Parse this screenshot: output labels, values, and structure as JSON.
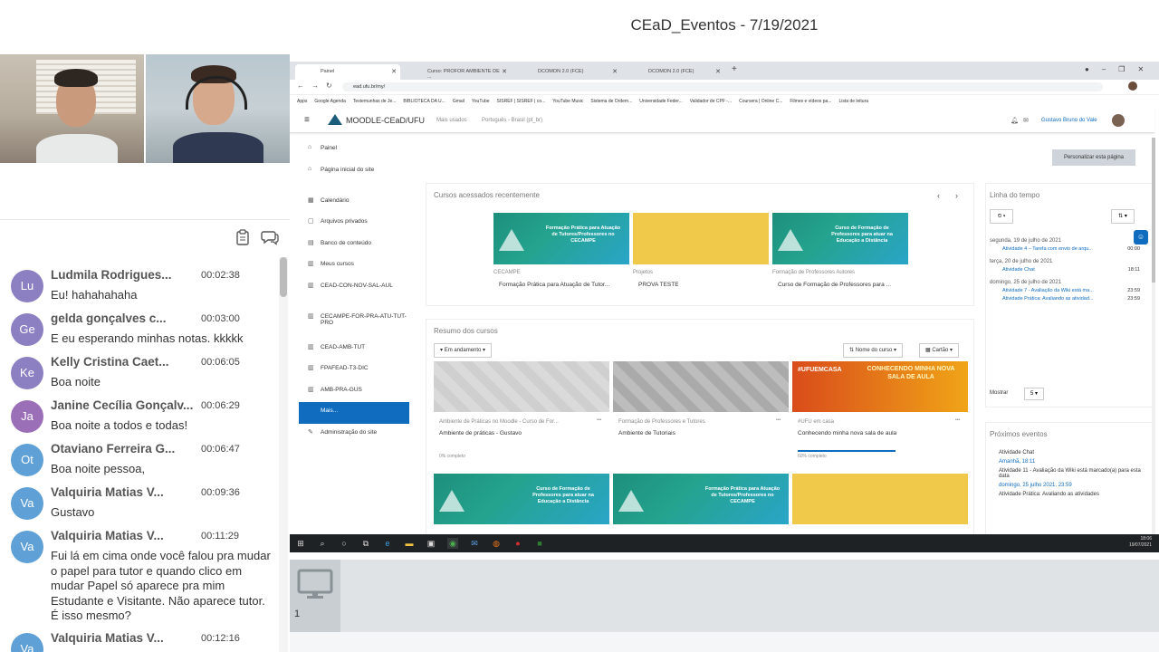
{
  "presentation": {
    "title": "CEaD_Eventos - 7/19/2021",
    "slide_number": "1"
  },
  "chat": {
    "messages": [
      {
        "initials": "Lu",
        "color": "#8c7fc2",
        "name": "Ludmila Rodrigues...",
        "time": "00:02:38",
        "text": "Eu! hahahahaha"
      },
      {
        "initials": "Ge",
        "color": "#8c7fc2",
        "name": "gelda gonçalves c...",
        "time": "00:03:00",
        "text": "E eu esperando minhas notas. kkkkk"
      },
      {
        "initials": "Ke",
        "color": "#8c7fc2",
        "name": "Kelly Cristina Caet...",
        "time": "00:06:05",
        "text": "Boa noite"
      },
      {
        "initials": "Ja",
        "color": "#9b6fb8",
        "name": "Janine Cecília Gonçalv...",
        "time": "00:06:29",
        "text": "Boa noite a todos e todas!"
      },
      {
        "initials": "Ot",
        "color": "#5fa0d6",
        "name": "Otaviano Ferreira G...",
        "time": "00:06:47",
        "text": "Boa noite pessoa,"
      },
      {
        "initials": "Va",
        "color": "#5fa0d6",
        "name": "Valquiria Matias V...",
        "time": "00:09:36",
        "text": "Gustavo"
      },
      {
        "initials": "Va",
        "color": "#5fa0d6",
        "name": "Valquiria Matias V...",
        "time": "00:11:29",
        "text": "Fui lá em cima onde você falou pra mudar o papel para tutor e quando clico em mudar  Papel só aparece pra mim Estudante e Visitante. Não aparece tutor. É isso mesmo?"
      },
      {
        "initials": "Va",
        "color": "#5fa0d6",
        "name": "Valquiria Matias V...",
        "time": "00:12:16",
        "text": ""
      }
    ]
  },
  "browser": {
    "tabs": [
      "Painel",
      "Curso: PROFOR AMBIENTE DE ...",
      "DCOMON 2.0 (FCE)",
      "DCOMON 2.0 (FCE)"
    ],
    "url": "ead.ufu.br/my/",
    "bookmarks": [
      "Apps",
      "Google Agenda",
      "Testemunhas de Je...",
      "BIBLIOTECA DA U...",
      "Gmail",
      "YouTube",
      "SISREF | SISREF | co...",
      "YouTube Music",
      "Sistema de Ordem...",
      "Universidade Feder...",
      "Validador de CPF -...",
      "Coursera | Online C...",
      "Filmes e vídeos pa...",
      "Lista de leitura"
    ]
  },
  "moodle": {
    "brand": "MOODLE-CEaD/UFU",
    "nav_links": [
      "Mais usados",
      "Português - Brasil (pt_br)"
    ],
    "user": "Gustavo Bruno do Vale",
    "customize_button": "Personalizar esta página",
    "drawer": [
      {
        "icon": "⌂",
        "label": "Painel",
        "active": false
      },
      {
        "icon": "⌂",
        "label": "Página inicial do site",
        "active": false
      },
      {
        "icon": "▦",
        "label": "Calendário",
        "active": false
      },
      {
        "icon": "▢",
        "label": "Arquivos privados",
        "active": false
      },
      {
        "icon": "▤",
        "label": "Banco de conteúdo",
        "active": false
      },
      {
        "icon": "▥",
        "label": "Meus cursos",
        "active": false
      },
      {
        "icon": "▥",
        "label": "CEAD-CON-NOV-SAL-AUL",
        "active": false
      },
      {
        "icon": "▥",
        "label": "CECAMPE-FOR-PRA-ATU-TUT-PRO",
        "active": false
      },
      {
        "icon": "▥",
        "label": "CEAD-AMB-TUT",
        "active": false
      },
      {
        "icon": "▥",
        "label": "FPAFEAD-T3-DIC",
        "active": false
      },
      {
        "icon": "▥",
        "label": "AMB-PRA-GUS",
        "active": false
      },
      {
        "icon": "",
        "label": "Mais...",
        "active": true
      },
      {
        "icon": "✎",
        "label": "Administração do site",
        "active": false
      }
    ],
    "recent": {
      "title": "Cursos acessados recentemente",
      "courses": [
        {
          "thumb": "teal",
          "thumb_text": "Formação Prática para Atuação de Tutores/Professores no CECAMPE",
          "category": "CECAMPE",
          "title": "Formação Prática para Atuação de Tutor..."
        },
        {
          "thumb": "yellow",
          "thumb_text": "",
          "category": "Projetos",
          "title": "PROVA TESTE"
        },
        {
          "thumb": "teal",
          "thumb_text": "Curso de Formação de Professores para atuar na Educação a Distância",
          "category": "Formação de Professores Autores",
          "title": "Curso de Formação de Professores para ..."
        }
      ]
    },
    "overview": {
      "title": "Resumo dos cursos",
      "filter": "Em andamento",
      "sort": "Nome do curso",
      "view": "Cartão",
      "courses": [
        {
          "thumb": "grey",
          "thumb_text": "",
          "category": "Ambiente de Práticas no Moodle - Curso de For...",
          "title": "Ambiente de práticas - Gustavo",
          "progress": "0% completo",
          "progress_value": 0
        },
        {
          "thumb": "grey2",
          "thumb_text": "",
          "category": "Formação de Professores e Tutores",
          "title": "Ambiente de Tutoriais",
          "progress": "",
          "progress_value": 0
        },
        {
          "thumb": "orange",
          "thumb_text": "CONHECENDO MINHA NOVA SALA DE AULA",
          "hashtag": "#UFUEMCASA",
          "category": "#UFU em casa",
          "title": "Conhecendo minha nova sala de aula",
          "progress": "60% completo",
          "progress_value": 60
        },
        {
          "thumb": "teal",
          "thumb_text": "Curso de Formação de Professores para atuar na Educação a Distância",
          "category": "",
          "title": "",
          "progress": "",
          "progress_value": 0
        },
        {
          "thumb": "teal",
          "thumb_text": "Formação Prática para Atuação de Tutores/Professores no CECAMPE",
          "category": "",
          "title": "",
          "progress": "",
          "progress_value": 0
        },
        {
          "thumb": "yellow",
          "thumb_text": "",
          "category": "",
          "title": "",
          "progress": "",
          "progress_value": 0
        }
      ]
    },
    "timeline": {
      "title": "Linha do tempo",
      "groups": [
        {
          "date": "segunda, 19 de julho de 2021",
          "items": [
            {
              "label": "Atividade 4 – Tarefa com envio de arqu...",
              "time": "00:00"
            }
          ]
        },
        {
          "date": "terça, 20 de julho de 2021",
          "items": [
            {
              "label": "Atividade Chat",
              "time": "18:11"
            }
          ]
        },
        {
          "date": "domingo, 25 de julho de 2021",
          "items": [
            {
              "label": "Atividade 7 - Avaliação da Wiki está ma...",
              "time": "23:59"
            },
            {
              "label": "Atividade Prática: Avaliando as atividad...",
              "time": "23:59"
            }
          ]
        }
      ],
      "show_label": "Mostrar",
      "show_value": "5"
    },
    "upcoming": {
      "title": "Próximos eventos",
      "events": [
        "Atividade Chat",
        "Amanhã, 18:11",
        "Atividade 11 - Avaliação da Wiki está marcado(a) para esta data",
        "domingo, 25 julho 2021, 23:59",
        "Atividade Prática: Avaliando as atividades"
      ]
    }
  },
  "taskbar": {
    "clock": "18:06",
    "date": "19/07/2021"
  }
}
